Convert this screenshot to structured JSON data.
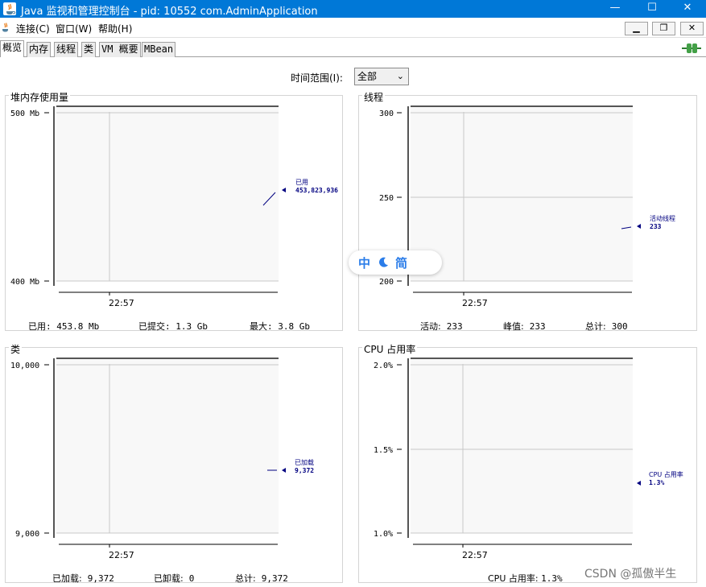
{
  "window": {
    "title": "Java 监视和管理控制台 - pid: 10552 com.AdminApplication",
    "minimize": "—",
    "maximize": "☐",
    "close": "✕"
  },
  "menu": {
    "items": [
      "连接(C)",
      "窗口(W)",
      "帮助(H)"
    ],
    "mdi": {
      "minimize": "▁",
      "restore": "❐",
      "close": "✕"
    }
  },
  "tabs": [
    "概览",
    "内存",
    "线程",
    "类",
    "VM 概要",
    "MBean"
  ],
  "time_range": {
    "label": "时间范围(I):",
    "value": "全部"
  },
  "panels": {
    "heap": {
      "title": "堆内存使用量",
      "y_labels": [
        "500 Mb",
        "400 Mb"
      ],
      "x_label": "22:57",
      "legend": {
        "name": "已用",
        "value": "453,823,936"
      },
      "footer": [
        {
          "label": "已用:",
          "value": "453.8",
          "unit": "Mb"
        },
        {
          "label": "已提交:",
          "value": "1.3",
          "unit": "Gb"
        },
        {
          "label": "最大:",
          "value": "3.8",
          "unit": "Gb"
        }
      ]
    },
    "threads": {
      "title": "线程",
      "y_labels": [
        "300",
        "250",
        "200"
      ],
      "x_label": "22:57",
      "legend": {
        "name": "活动线程",
        "value": "233"
      },
      "footer": [
        {
          "label": "活动:",
          "value": "233"
        },
        {
          "label": "峰值:",
          "value": "233"
        },
        {
          "label": "总计:",
          "value": "300"
        }
      ]
    },
    "classes": {
      "title": "类",
      "y_labels": [
        "10,000",
        "9,000"
      ],
      "x_label": "22:57",
      "legend": {
        "name": "已加载",
        "value": "9,372"
      },
      "footer": [
        {
          "label": "已加载:",
          "value": "9,372"
        },
        {
          "label": "已卸载:",
          "value": "0"
        },
        {
          "label": "总计:",
          "value": "9,372"
        }
      ]
    },
    "cpu": {
      "title": "CPU 占用率",
      "y_labels": [
        "2.0%",
        "1.5%",
        "1.0%"
      ],
      "x_label": "22:57",
      "legend": {
        "name": "CPU 占用率",
        "value": "1.3%"
      },
      "footer": [
        {
          "label": "CPU 占用率:",
          "value": "1.3%"
        }
      ]
    }
  },
  "chart_data": [
    {
      "type": "line",
      "title": "堆内存使用量",
      "ylim": [
        400,
        500
      ],
      "y_unit": "Mb",
      "x": [
        "22:57"
      ],
      "series": [
        {
          "name": "已用",
          "values": [
            453.8
          ]
        }
      ]
    },
    {
      "type": "line",
      "title": "线程",
      "ylim": [
        200,
        300
      ],
      "x": [
        "22:57"
      ],
      "series": [
        {
          "name": "活动线程",
          "values": [
            233
          ]
        }
      ]
    },
    {
      "type": "line",
      "title": "类",
      "ylim": [
        9000,
        10000
      ],
      "x": [
        "22:57"
      ],
      "series": [
        {
          "name": "已加载",
          "values": [
            9372
          ]
        }
      ]
    },
    {
      "type": "line",
      "title": "CPU 占用率",
      "ylim": [
        1.0,
        2.0
      ],
      "y_unit": "%",
      "x": [
        "22:57"
      ],
      "series": [
        {
          "name": "CPU 占用率",
          "values": [
            1.3
          ]
        }
      ]
    }
  ],
  "ime": {
    "lang": "中",
    "mode": "简"
  },
  "watermark": "CSDN @孤傲半生",
  "colors": {
    "titlebar": "#0078d7",
    "series": "#000080",
    "plot_bg": "#f8f8f8",
    "grid": "#c8c8c8"
  }
}
